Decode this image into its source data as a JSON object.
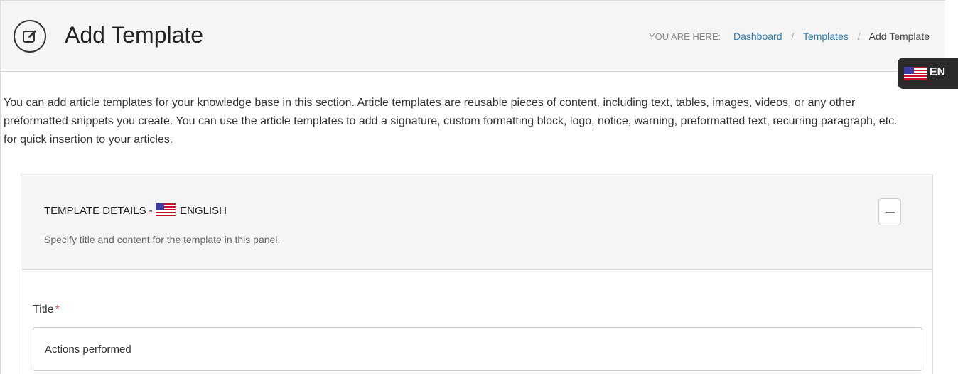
{
  "header": {
    "title": "Add Template",
    "icon": "edit-icon"
  },
  "breadcrumb": {
    "prefix": "YOU ARE HERE:",
    "items": [
      {
        "label": "Dashboard",
        "link": true
      },
      {
        "label": "Templates",
        "link": true
      },
      {
        "label": "Add Template",
        "link": false
      }
    ],
    "separator": "/"
  },
  "language_switcher": {
    "code": "EN",
    "flag_icon": "us-flag-icon"
  },
  "intro_text": "You can add article templates for your knowledge base in this section. Article templates are reusable pieces of content, including text, tables, images, videos, or any other preformatted snippets you create. You can use the article templates to add a signature, custom formatting block, logo, notice, warning, preformatted text, recurring paragraph, etc. for quick insertion to your articles.",
  "panel": {
    "title_prefix": "TEMPLATE DETAILS -",
    "language": "ENGLISH",
    "subtitle": "Specify title and content for the template in this panel.",
    "collapse_icon": "minus-icon"
  },
  "form": {
    "title_label": "Title",
    "required_mark": "*",
    "title_value": "Actions performed"
  },
  "colors": {
    "link": "#2a7ab0",
    "required": "#d9534f",
    "header_bg": "#f5f5f5",
    "badge_bg": "#2b2b2b"
  }
}
